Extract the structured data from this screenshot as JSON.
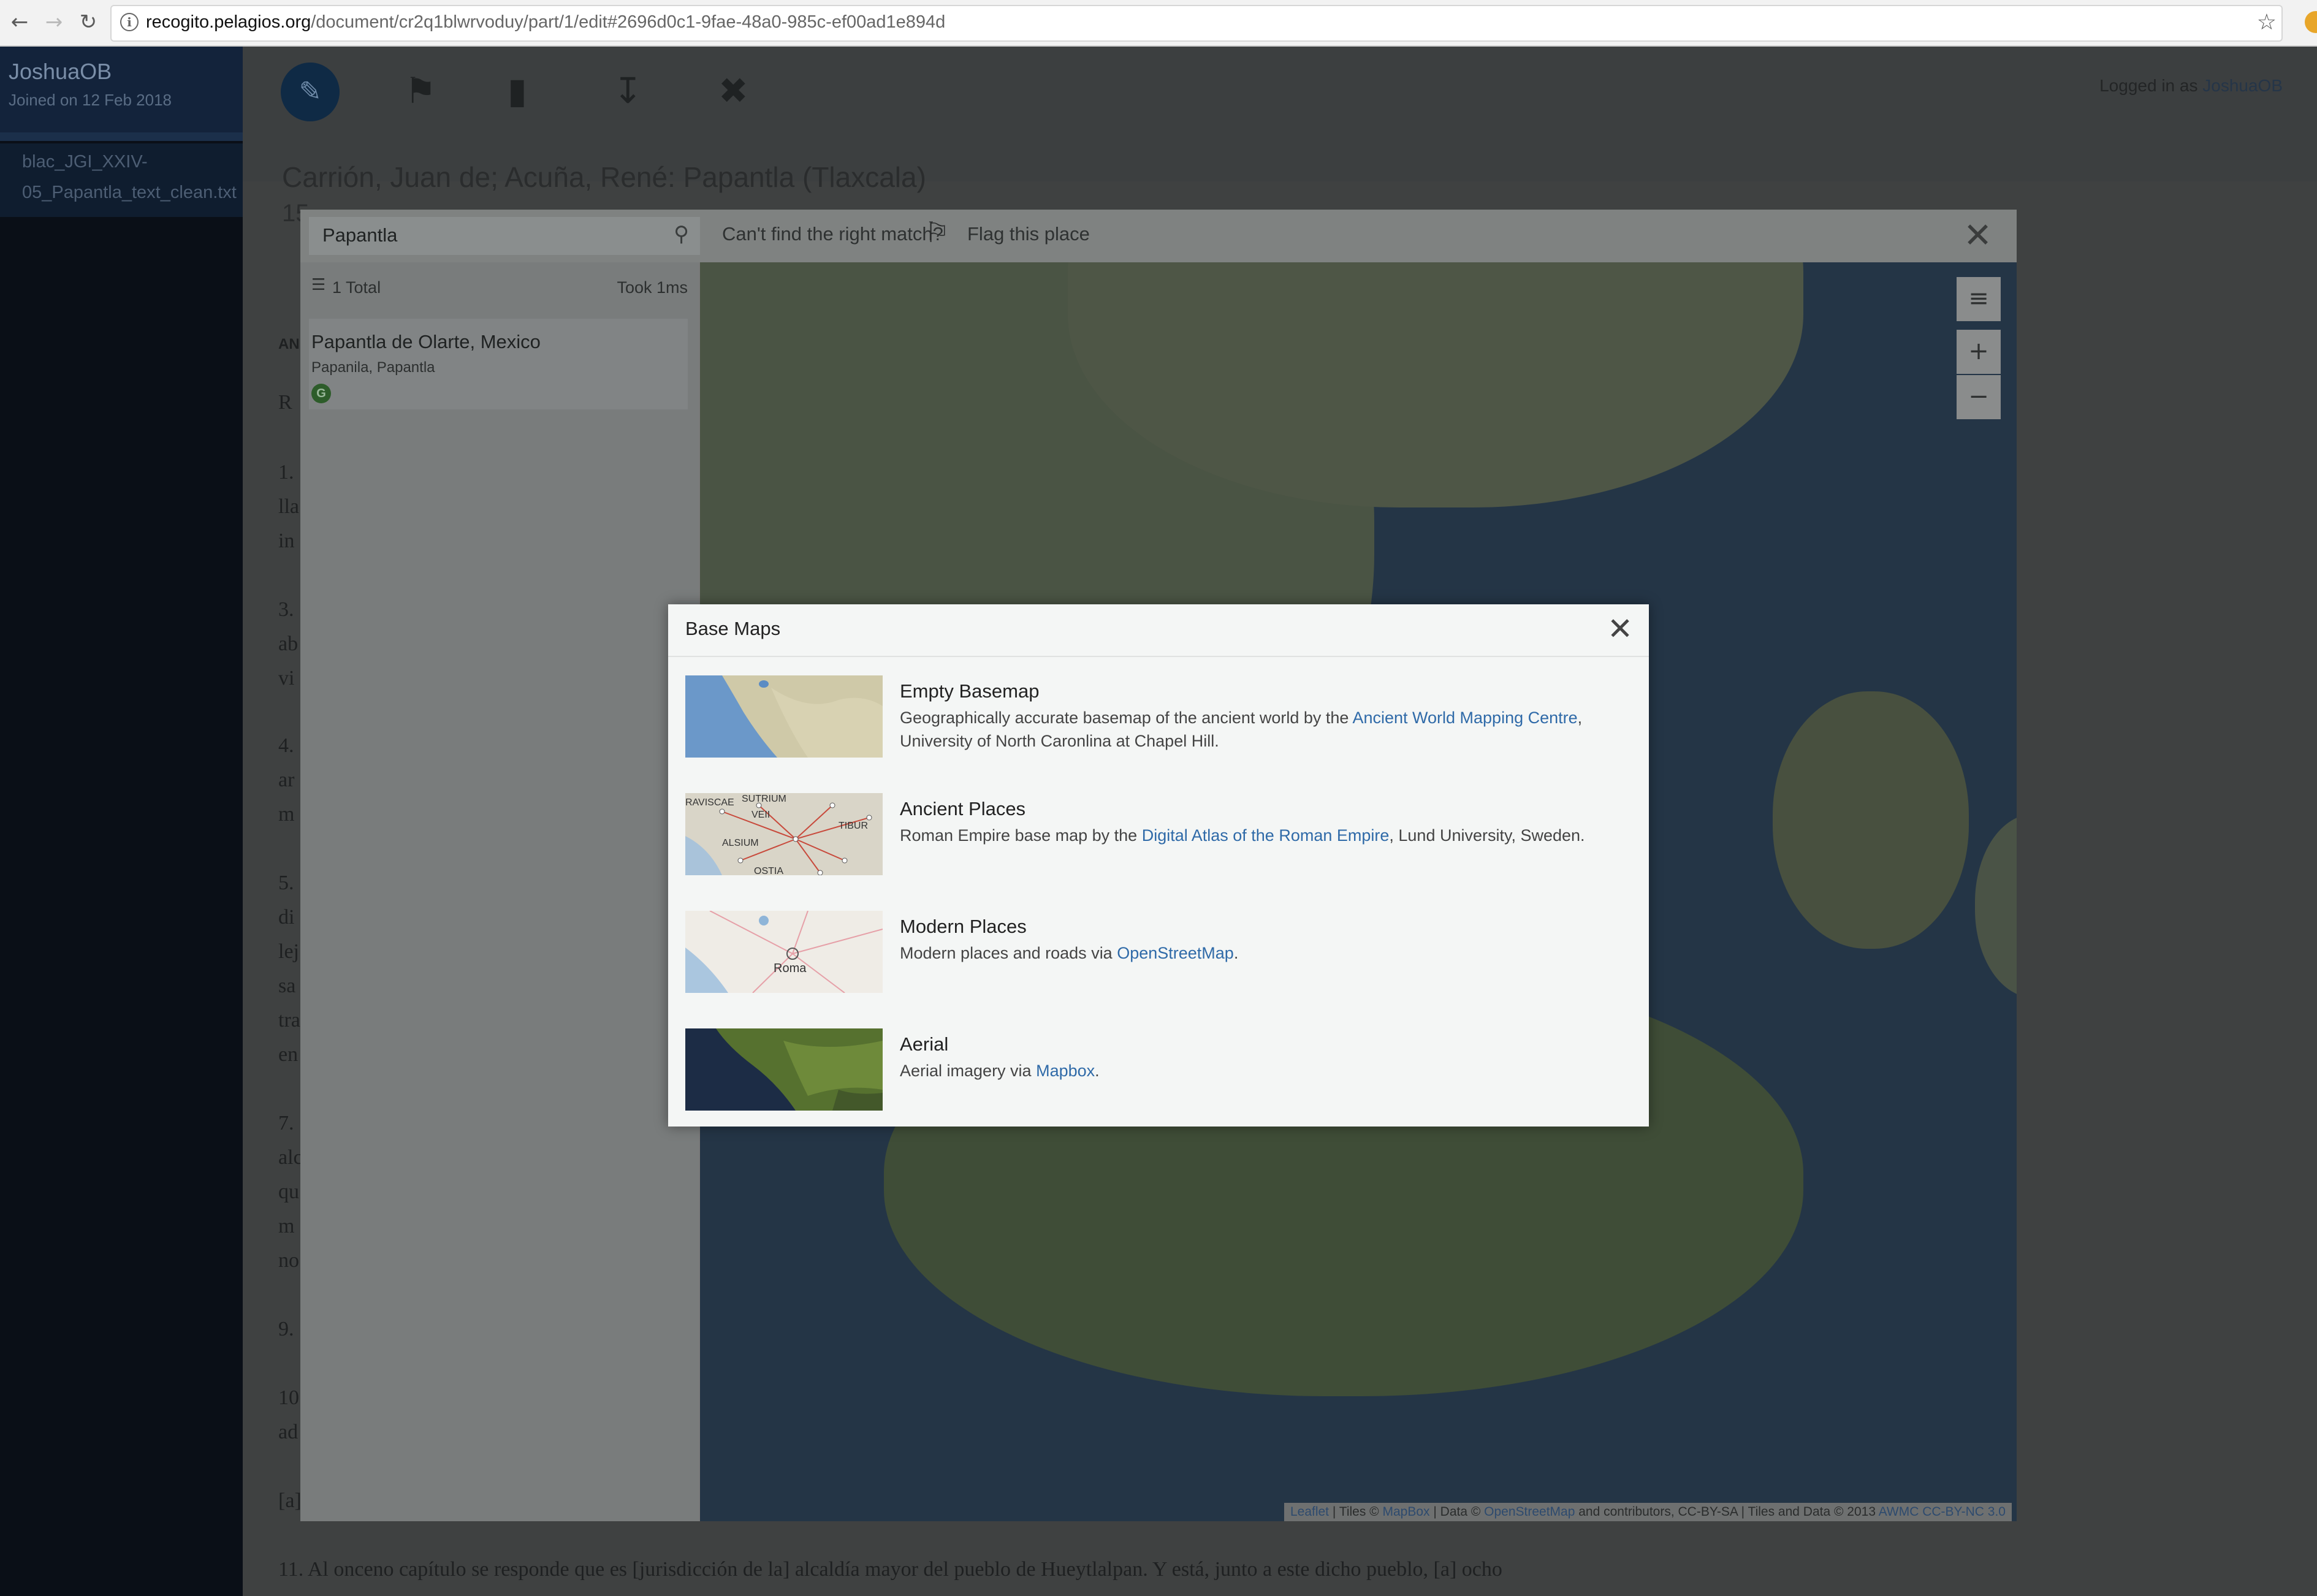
{
  "browser": {
    "url_host": "recogito.pelagios.org",
    "url_path": "/document/cr2q1blwrvoduy/part/1/edit#2696d0c1-9fae-48a0-985c-ef00ad1e894d",
    "back_icon": "arrow-left-icon",
    "forward_icon": "arrow-right-icon",
    "reload_icon": "reload-icon",
    "info_icon": "info-icon",
    "bookmark_icon": "star-icon"
  },
  "sidebar": {
    "username": "JoshuaOB",
    "joined": "Joined on 12 Feb 2018",
    "document_line1": "blac_JGI_XXIV-",
    "document_line2": "05_Papantla_text_clean.txt"
  },
  "header": {
    "logged_in_prefix": "Logged in as ",
    "logged_in_user": "JoshuaOB"
  },
  "document": {
    "title": "Carrión, Juan de; Acuña, René: Papantla (Tlaxcala)",
    "subtitle": "15",
    "tab_fragment": "AN",
    "line_r": "R",
    "line_1": "1.",
    "line_1b": "lla",
    "line_1c": "in",
    "line_3": "3.",
    "line_3b": "ab",
    "line_3c": "vi",
    "line_4": "4.",
    "line_4b": "ar",
    "line_4c": "m",
    "line_5": "5.",
    "line_5b": "di",
    "line_5c": "lej",
    "line_5d": "sa",
    "line_5e": "tra",
    "line_5f": "en",
    "line_7": "7.",
    "line_7b": "alc",
    "line_7c": "qu",
    "line_7d": "m",
    "line_7e": "no",
    "line_9": "9.",
    "line_10": "10",
    "line_10b": "ad",
    "line_a": "[a]",
    "line_11": "11. Al onceno capítulo se responde que es [jurisdicción de la] alcaldía mayor del pueblo de Hueytlalpan. Y está, junto a este dicho pueblo, [a] ocho"
  },
  "geo_modal": {
    "search_value": "Papantla",
    "cant_find": "Can't find the right match?",
    "flag_label": "Flag this place",
    "total": "1 Total",
    "took": "Took 1ms",
    "result_title": "Papantla de Olarte, Mexico",
    "result_alt": "Papanila, Papantla",
    "result_badge": "G",
    "zoom_in": "+",
    "zoom_out": "−",
    "layers_icon": "hamburger-icon"
  },
  "attribution": {
    "leaflet": "Leaflet",
    "tiles_prefix": " | Tiles © ",
    "mapbox": "MapBox",
    "data_prefix": " | Data © ",
    "osm": "OpenStreetMap",
    "rest": " and contributors, CC-BY-SA | Tiles and Data © 2013 ",
    "awmc": "AWMC CC-BY-NC 3.0"
  },
  "base_maps": {
    "title": "Base Maps",
    "items": [
      {
        "name": "Empty Basemap",
        "desc_pre": "Geographically accurate basemap of the ancient world by the ",
        "link": "Ancient World Mapping Centre",
        "desc_post": ", University of North Caronlina at Chapel Hill."
      },
      {
        "name": "Ancient Places",
        "desc_pre": "Roman Empire base map by the ",
        "link": "Digital Atlas of the Roman Empire",
        "desc_post": ", Lund University, Sweden."
      },
      {
        "name": "Modern Places",
        "desc_pre": "Modern places and roads via ",
        "link": "OpenStreetMap",
        "desc_post": "."
      },
      {
        "name": "Aerial",
        "desc_pre": "Aerial imagery via ",
        "link": "Mapbox",
        "desc_post": "."
      }
    ],
    "thumb_labels": {
      "raviscae": "RAVISCAE",
      "sutrium": "SUTRIUM",
      "veii": "VEII",
      "tibur": "TIBUR",
      "alsium": "ALSIUM",
      "ostia": "OSTIA",
      "roma": "Roma"
    }
  }
}
